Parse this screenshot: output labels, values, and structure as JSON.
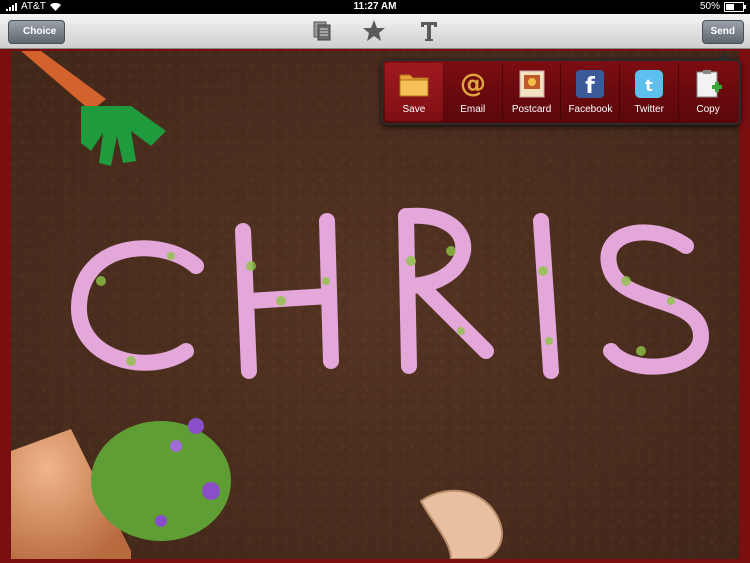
{
  "status": {
    "carrier": "AT&T",
    "time": "11:27 AM",
    "battery": "50%",
    "battery_level": 0.5
  },
  "toolbar": {
    "choice_label": "Choice",
    "send_label": "Send"
  },
  "photo": {
    "text_on_photo": "CHRIS"
  },
  "share_menu": {
    "items": [
      {
        "label": "Save",
        "icon": "folder-icon"
      },
      {
        "label": "Email",
        "icon": "at-sign-icon"
      },
      {
        "label": "Postcard",
        "icon": "postcard-icon"
      },
      {
        "label": "Facebook",
        "icon": "facebook-icon"
      },
      {
        "label": "Twitter",
        "icon": "twitter-icon"
      },
      {
        "label": "Copy",
        "icon": "clipboard-add-icon"
      }
    ]
  },
  "colors": {
    "accent": "#7c0d12",
    "frame": "#7a0f12",
    "soil": "#4a2d1e",
    "flower": "#e2a8d8"
  }
}
